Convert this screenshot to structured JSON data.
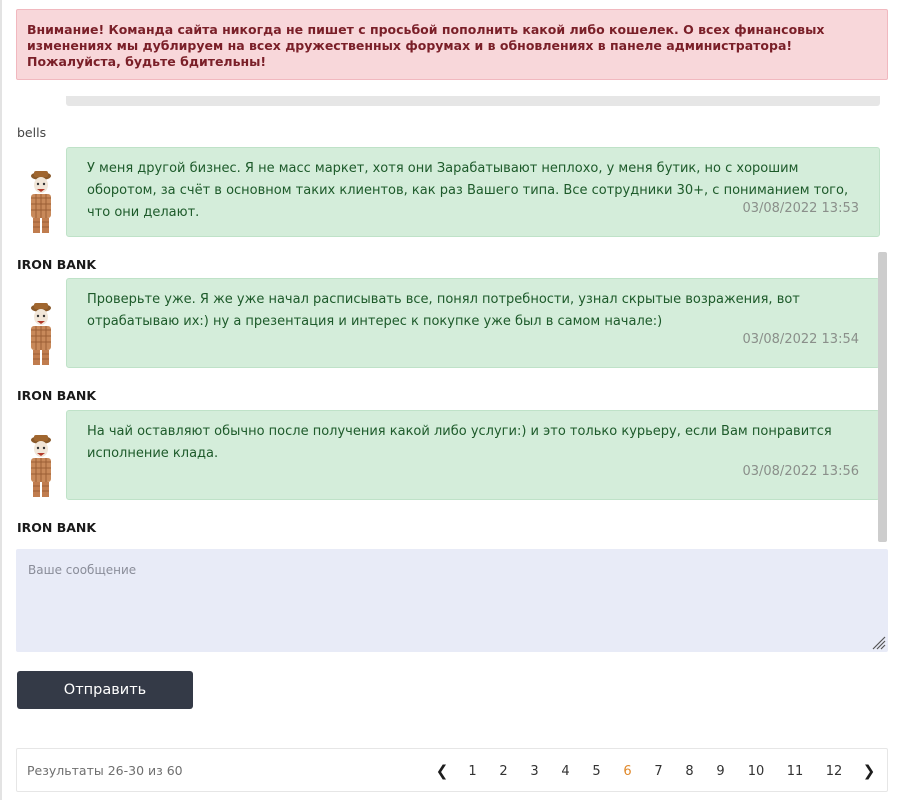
{
  "alert": {
    "text": "Внимание! Команда сайта никогда не пишет с просьбой пополнить какой либо кошелек. О всех финансовых изменениях мы дублируем на всех дружественных форумах и в обновлениях в панеле администратора! Пожалуйста, будьте бдительны!"
  },
  "chat": {
    "messages": [
      {
        "author": "bells",
        "text": "У меня другой бизнес. Я не масс маркет, хотя они Зарабатывают неплохо, у меня бутик, но с хорошим оборотом, за счёт в основном таких клиентов, как раз Вашего типа. Все сотрудники 30+, с пониманием того, что они делают.",
        "time": "03/08/2022 13:53"
      },
      {
        "author": "IRON BANK",
        "text": "Проверьте уже. Я же уже начал расписывать все, понял потребности, узнал скрытые возражения, вот отрабатываю их:) ну а презентация и интерес к покупке уже был в самом начале:)",
        "time": "03/08/2022 13:54"
      },
      {
        "author": "IRON BANK",
        "text": "На чай оставляют обычно после получения какой либо услуги:) и это только курьеру, если Вам понравится исполнение клада.",
        "time": "03/08/2022 13:56"
      }
    ],
    "last_author": "IRON BANK"
  },
  "composer": {
    "placeholder": "Ваше сообщение",
    "send_label": "Отправить"
  },
  "pagination": {
    "results_text": "Результаты 26-30 из 60",
    "pages": [
      "1",
      "2",
      "3",
      "4",
      "5",
      "6",
      "7",
      "8",
      "9",
      "10",
      "11",
      "12"
    ],
    "current_page": "6",
    "prev_icon": "chevron-left-icon",
    "next_icon": "chevron-right-icon"
  },
  "colors": {
    "alert_bg": "#f8d7da",
    "alert_text": "#7a1f28",
    "bubble_bg": "#d4edda",
    "bubble_text": "#1d5a2a",
    "input_bg": "#e8ebf7",
    "button_bg": "#343a47",
    "active_page": "#e0892b"
  }
}
